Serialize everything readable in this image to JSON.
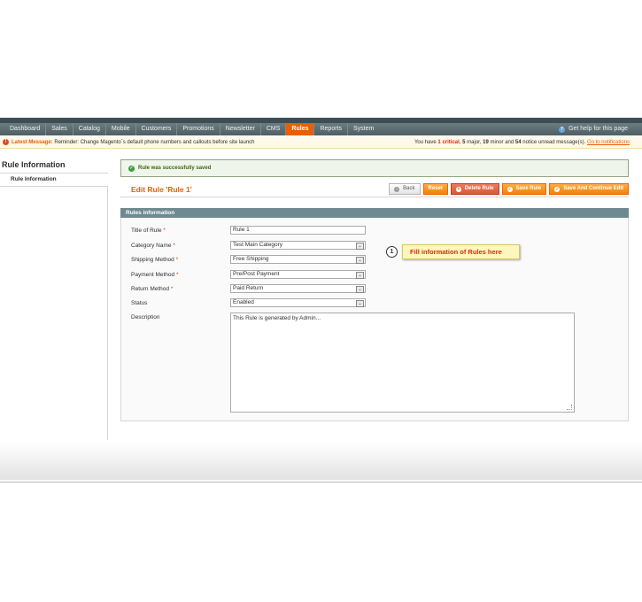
{
  "nav": {
    "items": [
      "Dashboard",
      "Sales",
      "Catalog",
      "Mobile",
      "Customers",
      "Promotions",
      "Newsletter",
      "CMS",
      "Rules",
      "Reports",
      "System"
    ],
    "active": "Rules",
    "help": "Get help for this page"
  },
  "message": {
    "label": "Latest Message:",
    "text": "Reminder: Change Magento`s default phone numbers and callouts before site launch",
    "right_prefix": "You have",
    "critical_count": "1",
    "critical_label": "critical",
    "major_count": "5",
    "major_label": "major,",
    "minor_count": "19",
    "minor_label": "minor and",
    "notice_count": "54",
    "notice_label": "notice unread message(s).",
    "link": "Go to notifications"
  },
  "sidebar": {
    "title": "Rule Information",
    "tab": "Rule Information"
  },
  "success": "Rule was successfully saved",
  "header": {
    "title": "Edit Rule 'Rule 1'",
    "back": "Back",
    "reset": "Reset",
    "delete": "Delete Rule",
    "save": "Save Rule",
    "save_continue": "Save And Continue Edit"
  },
  "form": {
    "legend": "Rules information",
    "title_label": "Title of Rule",
    "title_value": "Rule 1",
    "category_label": "Category Name",
    "category_value": "Test Main Category",
    "shipping_label": "Shipping Method",
    "shipping_value": "Free Shipping",
    "payment_label": "Payment Method",
    "payment_value": "Pre/Post Payment",
    "return_label": "Return Method",
    "return_value": "Paid Return",
    "status_label": "Status",
    "status_value": "Enabled",
    "description_label": "Description",
    "description_value": "This Rule is generated by Admin..."
  },
  "callout": {
    "number": "1",
    "text": "Fill information of Rules here"
  }
}
